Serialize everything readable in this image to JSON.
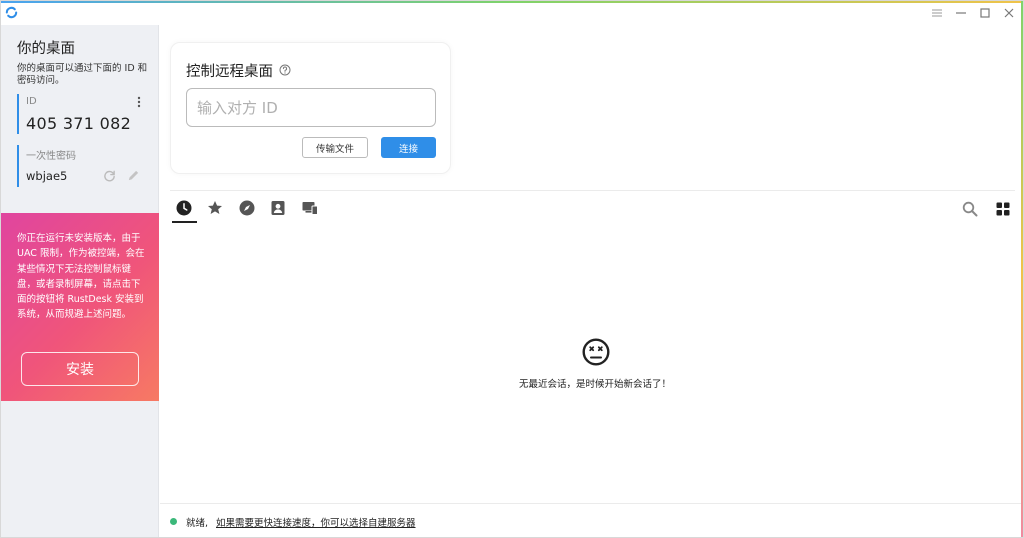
{
  "window": {
    "controls": {
      "menu_icon": "hamburger-icon",
      "minimize": "minimize-icon",
      "maximize": "maximize-icon",
      "close": "close-icon"
    }
  },
  "sidebar": {
    "title": "你的桌面",
    "description": "你的桌面可以通过下面的 ID 和密码访问。",
    "id_label": "ID",
    "id_value": "405 371 082",
    "password_label": "一次性密码",
    "password_value": "wbjae5",
    "warning_text": "你正在运行未安装版本，由于 UAC 限制，作为被控端，会在某些情况下无法控制鼠标键盘，或者录制屏幕，请点击下面的按钮将 RustDesk 安装到系统，从而规避上述问题。",
    "install_label": "安装"
  },
  "control": {
    "title": "控制远程桌面",
    "input_placeholder": "输入对方 ID",
    "transfer_label": "传输文件",
    "connect_label": "连接"
  },
  "tabs": [
    {
      "name": "recent-sessions",
      "icon": "clock-icon"
    },
    {
      "name": "favorites",
      "icon": "star-icon"
    },
    {
      "name": "discovered",
      "icon": "compass-icon"
    },
    {
      "name": "address-book",
      "icon": "contact-icon"
    },
    {
      "name": "group",
      "icon": "devices-icon"
    }
  ],
  "empty_state": {
    "icon": "sad-face-icon",
    "text": "无最近会话，是时候开始新会话了！"
  },
  "status": {
    "ready": "就绪,",
    "link": "如果需要更快连接速度，你可以选择自建服务器"
  },
  "colors": {
    "accent": "#2f8ee8",
    "status_ok": "#3bb87a",
    "warning_gradient_start": "#e0459f",
    "warning_gradient_end": "#f77a63"
  }
}
